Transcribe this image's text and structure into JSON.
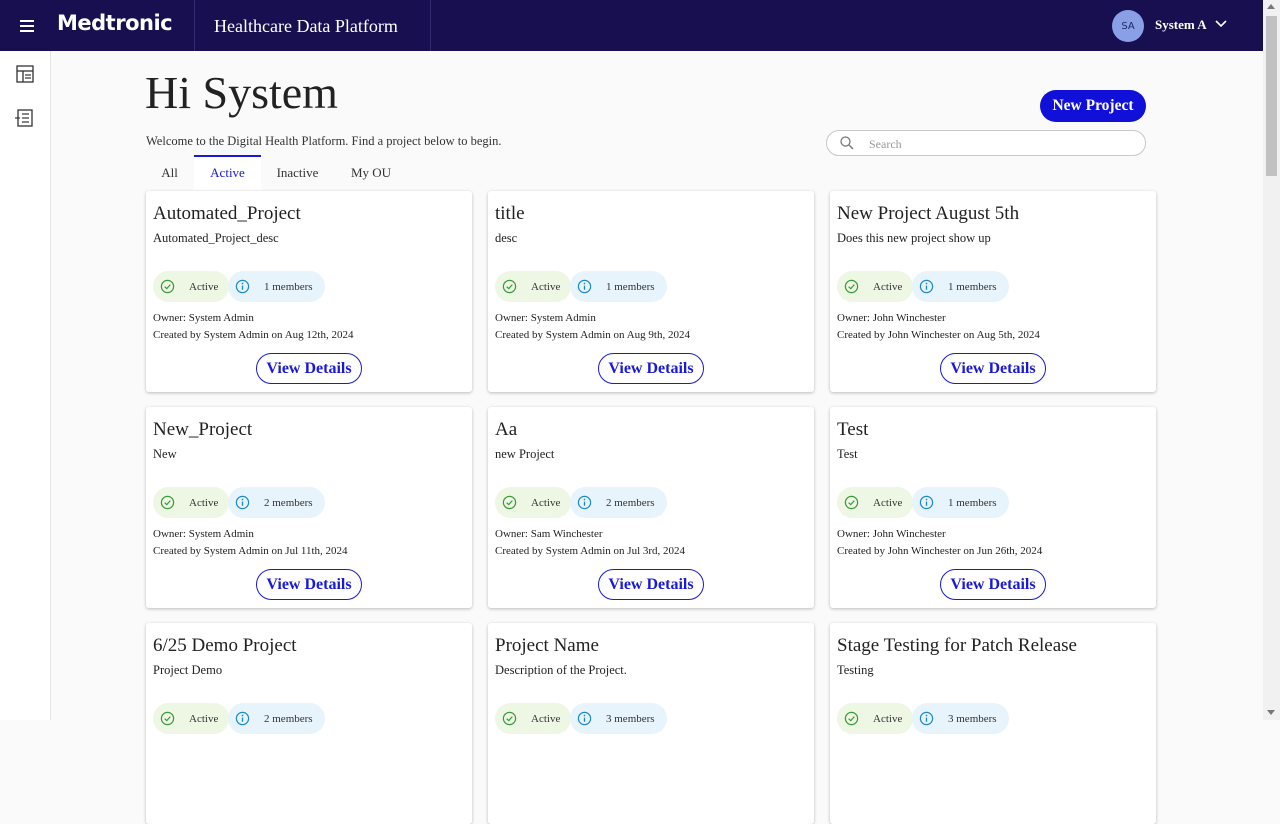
{
  "header": {
    "logo": "Medtronic",
    "platform_title": "Healthcare Data Platform",
    "user_initials": "SA",
    "user_name": "System A"
  },
  "main": {
    "greeting": "Hi System",
    "welcome": "Welcome to the Digital Health Platform. Find a project below to begin.",
    "new_project_label": "New Project",
    "search_placeholder": "Search",
    "tabs": [
      {
        "label": "All"
      },
      {
        "label": "Active",
        "selected": true
      },
      {
        "label": "Inactive"
      },
      {
        "label": "My OU"
      }
    ]
  },
  "projects": [
    {
      "title": "Automated_Project",
      "desc": "Automated_Project_desc",
      "status": "Active",
      "members": "1 members",
      "owner": "Owner: System Admin",
      "created": "Created by System Admin on Aug 12th, 2024",
      "action": "View Details"
    },
    {
      "title": "title",
      "desc": "desc",
      "status": "Active",
      "members": "1 members",
      "owner": "Owner: System Admin",
      "created": "Created by System Admin on Aug 9th, 2024",
      "action": "View Details"
    },
    {
      "title": "New Project August 5th",
      "desc": "Does this new project show up",
      "status": "Active",
      "members": "1 members",
      "owner": "Owner: John Winchester",
      "created": "Created by John Winchester on Aug 5th, 2024",
      "action": "View Details"
    },
    {
      "title": "New_Project",
      "desc": "New",
      "status": "Active",
      "members": "2 members",
      "owner": "Owner: System Admin",
      "created": "Created by System Admin on Jul 11th, 2024",
      "action": "View Details"
    },
    {
      "title": "Aa",
      "desc": "new Project",
      "status": "Active",
      "members": "2 members",
      "owner": "Owner: Sam Winchester",
      "created": "Created by System Admin on Jul 3rd, 2024",
      "action": "View Details"
    },
    {
      "title": "Test",
      "desc": "Test",
      "status": "Active",
      "members": "1 members",
      "owner": "Owner: John Winchester",
      "created": "Created by John Winchester on Jun 26th, 2024",
      "action": "View Details"
    },
    {
      "title": "6/25 Demo Project",
      "desc": "Project Demo",
      "status": "Active",
      "members": "2 members",
      "owner": "",
      "created": "",
      "action": ""
    },
    {
      "title": "Project Name",
      "desc": "Description of the Project.",
      "status": "Active",
      "members": "3 members",
      "owner": "",
      "created": "",
      "action": ""
    },
    {
      "title": "Stage Testing for Patch Release",
      "desc": "Testing",
      "status": "Active",
      "members": "3 members",
      "owner": "",
      "created": "",
      "action": ""
    }
  ],
  "colors": {
    "appbar": "#170f4f",
    "accent": "#1a1ad6",
    "status_chip": "#eef6e4",
    "members_chip": "#e7f4fb"
  }
}
